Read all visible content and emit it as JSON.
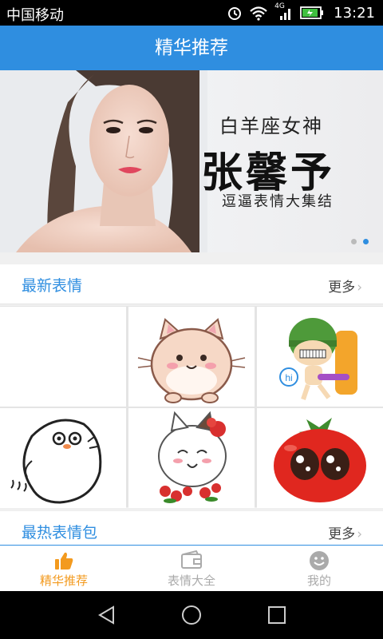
{
  "status_bar": {
    "carrier": "中国移动",
    "network": "4G",
    "time": "13:21"
  },
  "title_bar": {
    "title": "精华推荐"
  },
  "banner": {
    "line1": "白羊座女神",
    "line2": "张馨予",
    "line3": "逗逼表情大集结",
    "dots": [
      {
        "active": false
      },
      {
        "active": true
      }
    ]
  },
  "sections": {
    "latest": {
      "title": "最新表情",
      "more": "更多"
    },
    "hot": {
      "title": "最热表情包",
      "more": "更多"
    }
  },
  "stickers": [
    {
      "name": "blank"
    },
    {
      "name": "cream-cat"
    },
    {
      "name": "green-helmet-boy",
      "badge": "hi"
    },
    {
      "name": "round-seal"
    },
    {
      "name": "white-cat-flowers"
    },
    {
      "name": "red-tomato"
    }
  ],
  "tabs": [
    {
      "label": "精华推荐",
      "icon": "thumbs-up-icon",
      "active": true
    },
    {
      "label": "表情大全",
      "icon": "folder-icon",
      "active": false
    },
    {
      "label": "我的",
      "icon": "smiley-icon",
      "active": false
    }
  ],
  "colors": {
    "primary": "#2f8ee0",
    "accent": "#f39a1e",
    "inactive": "#aaaaaa"
  }
}
